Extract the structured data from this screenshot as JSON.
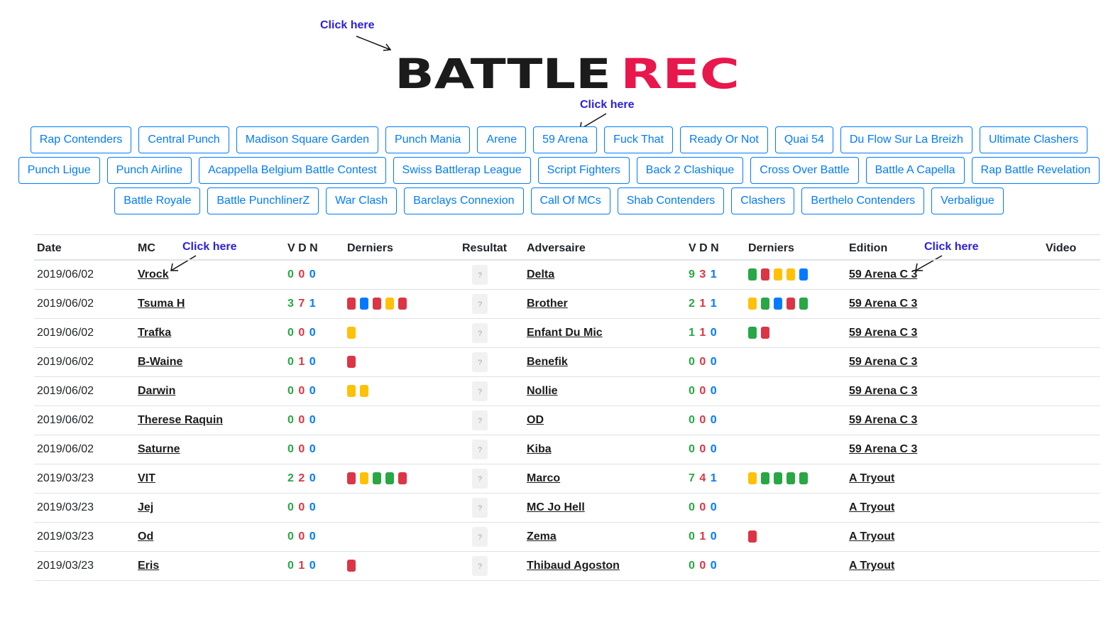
{
  "annotations": {
    "click_here": "Click here"
  },
  "logo": {
    "part1": "BATTLE",
    "part2": "REC",
    "colors": {
      "part1": "#1b1b1b",
      "part2": "#e8174c"
    }
  },
  "nav": {
    "rows": [
      [
        "Rap Contenders",
        "Central Punch",
        "Madison Square Garden",
        "Punch Mania",
        "Arene",
        "59 Arena",
        "Fuck That",
        "Ready Or Not",
        "Quai 54",
        "Du Flow Sur La Breizh",
        "Ultimate Clashers"
      ],
      [
        "Punch Ligue",
        "Punch Airline",
        "Acappella Belgium Battle Contest",
        "Swiss Battlerap League",
        "Script Fighters",
        "Back 2 Clashique",
        "Cross Over Battle",
        "Battle A Capella",
        "Rap Battle Revelation"
      ],
      [
        "Battle Royale",
        "Battle PunchlinerZ",
        "War Clash",
        "Barclays Connexion",
        "Call Of MCs",
        "Shab Contenders",
        "Clashers",
        "Berthelo Contenders",
        "Verbaligue"
      ]
    ]
  },
  "table": {
    "headers": {
      "date": "Date",
      "mc": "MC",
      "vdn": "V D N",
      "derniers": "Derniers",
      "resultat": "Resultat",
      "adversaire": "Adversaire",
      "vdn2": "V D N",
      "derniers2": "Derniers",
      "edition": "Edition",
      "video": "Video"
    },
    "result_placeholder": "?",
    "colors": {
      "green": "#28a745",
      "red": "#dc3545",
      "yellow": "#ffc107",
      "blue": "#007bff"
    },
    "rows": [
      {
        "date": "2019/06/02",
        "mc": "Vrock",
        "mc_vdn": [
          "0",
          "0",
          "0"
        ],
        "mc_last": [],
        "adv": "Delta",
        "adv_vdn": [
          "9",
          "3",
          "1"
        ],
        "adv_last": [
          "green",
          "red",
          "yellow",
          "yellow",
          "blue"
        ],
        "edition": "59 Arena C 3"
      },
      {
        "date": "2019/06/02",
        "mc": "Tsuma H",
        "mc_vdn": [
          "3",
          "7",
          "1"
        ],
        "mc_last": [
          "red",
          "blue",
          "red",
          "yellow",
          "red"
        ],
        "adv": "Brother",
        "adv_vdn": [
          "2",
          "1",
          "1"
        ],
        "adv_last": [
          "yellow",
          "green",
          "blue",
          "red",
          "green"
        ],
        "edition": "59 Arena C 3"
      },
      {
        "date": "2019/06/02",
        "mc": "Trafka",
        "mc_vdn": [
          "0",
          "0",
          "0"
        ],
        "mc_last": [
          "yellow"
        ],
        "adv": "Enfant Du Mic",
        "adv_vdn": [
          "1",
          "1",
          "0"
        ],
        "adv_last": [
          "green",
          "red"
        ],
        "edition": "59 Arena C 3"
      },
      {
        "date": "2019/06/02",
        "mc": "B-Waine",
        "mc_vdn": [
          "0",
          "1",
          "0"
        ],
        "mc_last": [
          "red"
        ],
        "adv": "Benefik",
        "adv_vdn": [
          "0",
          "0",
          "0"
        ],
        "adv_last": [],
        "edition": "59 Arena C 3"
      },
      {
        "date": "2019/06/02",
        "mc": "Darwin",
        "mc_vdn": [
          "0",
          "0",
          "0"
        ],
        "mc_last": [
          "yellow",
          "yellow"
        ],
        "adv": "Nollie",
        "adv_vdn": [
          "0",
          "0",
          "0"
        ],
        "adv_last": [],
        "edition": "59 Arena C 3"
      },
      {
        "date": "2019/06/02",
        "mc": "Therese Raquin",
        "mc_vdn": [
          "0",
          "0",
          "0"
        ],
        "mc_last": [],
        "adv": "OD",
        "adv_vdn": [
          "0",
          "0",
          "0"
        ],
        "adv_last": [],
        "edition": "59 Arena C 3"
      },
      {
        "date": "2019/06/02",
        "mc": "Saturne",
        "mc_vdn": [
          "0",
          "0",
          "0"
        ],
        "mc_last": [],
        "adv": "Kiba",
        "adv_vdn": [
          "0",
          "0",
          "0"
        ],
        "adv_last": [],
        "edition": "59 Arena C 3"
      },
      {
        "date": "2019/03/23",
        "mc": "VIT",
        "mc_vdn": [
          "2",
          "2",
          "0"
        ],
        "mc_last": [
          "red",
          "yellow",
          "green",
          "green",
          "red"
        ],
        "adv": "Marco",
        "adv_vdn": [
          "7",
          "4",
          "1"
        ],
        "adv_last": [
          "yellow",
          "green",
          "green",
          "green",
          "green"
        ],
        "edition": "A Tryout"
      },
      {
        "date": "2019/03/23",
        "mc": "Jej",
        "mc_vdn": [
          "0",
          "0",
          "0"
        ],
        "mc_last": [],
        "adv": "MC Jo Hell",
        "adv_vdn": [
          "0",
          "0",
          "0"
        ],
        "adv_last": [],
        "edition": "A Tryout"
      },
      {
        "date": "2019/03/23",
        "mc": "Od",
        "mc_vdn": [
          "0",
          "0",
          "0"
        ],
        "mc_last": [],
        "adv": "Zema",
        "adv_vdn": [
          "0",
          "1",
          "0"
        ],
        "adv_last": [
          "red"
        ],
        "edition": "A Tryout"
      },
      {
        "date": "2019/03/23",
        "mc": "Eris",
        "mc_vdn": [
          "0",
          "1",
          "0"
        ],
        "mc_last": [
          "red"
        ],
        "adv": "Thibaud Agoston",
        "adv_vdn": [
          "0",
          "0",
          "0"
        ],
        "adv_last": [],
        "edition": "A Tryout"
      }
    ]
  }
}
